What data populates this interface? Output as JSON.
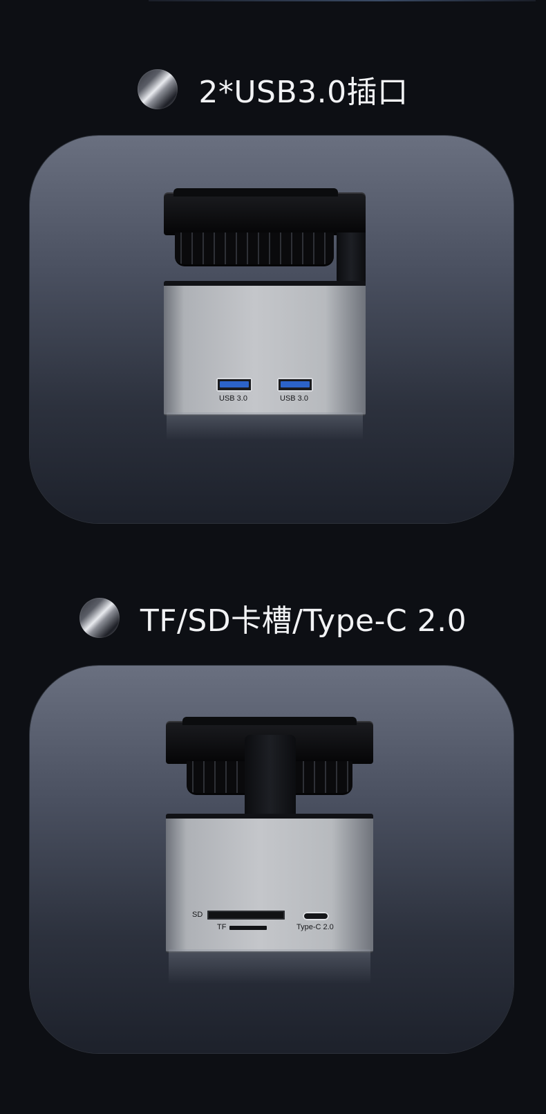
{
  "section1": {
    "title": "2*USB3.0插口",
    "ports": [
      {
        "label": "USB 3.0"
      },
      {
        "label": "USB 3.0"
      }
    ]
  },
  "section2": {
    "title": "TF/SD卡槽/Type-C 2.0",
    "sd_label": "SD",
    "tf_label": "TF",
    "typec_label": "Type-C 2.0"
  },
  "colors": {
    "background": "#0d0f14",
    "usb_blue": "#2c63c9"
  }
}
